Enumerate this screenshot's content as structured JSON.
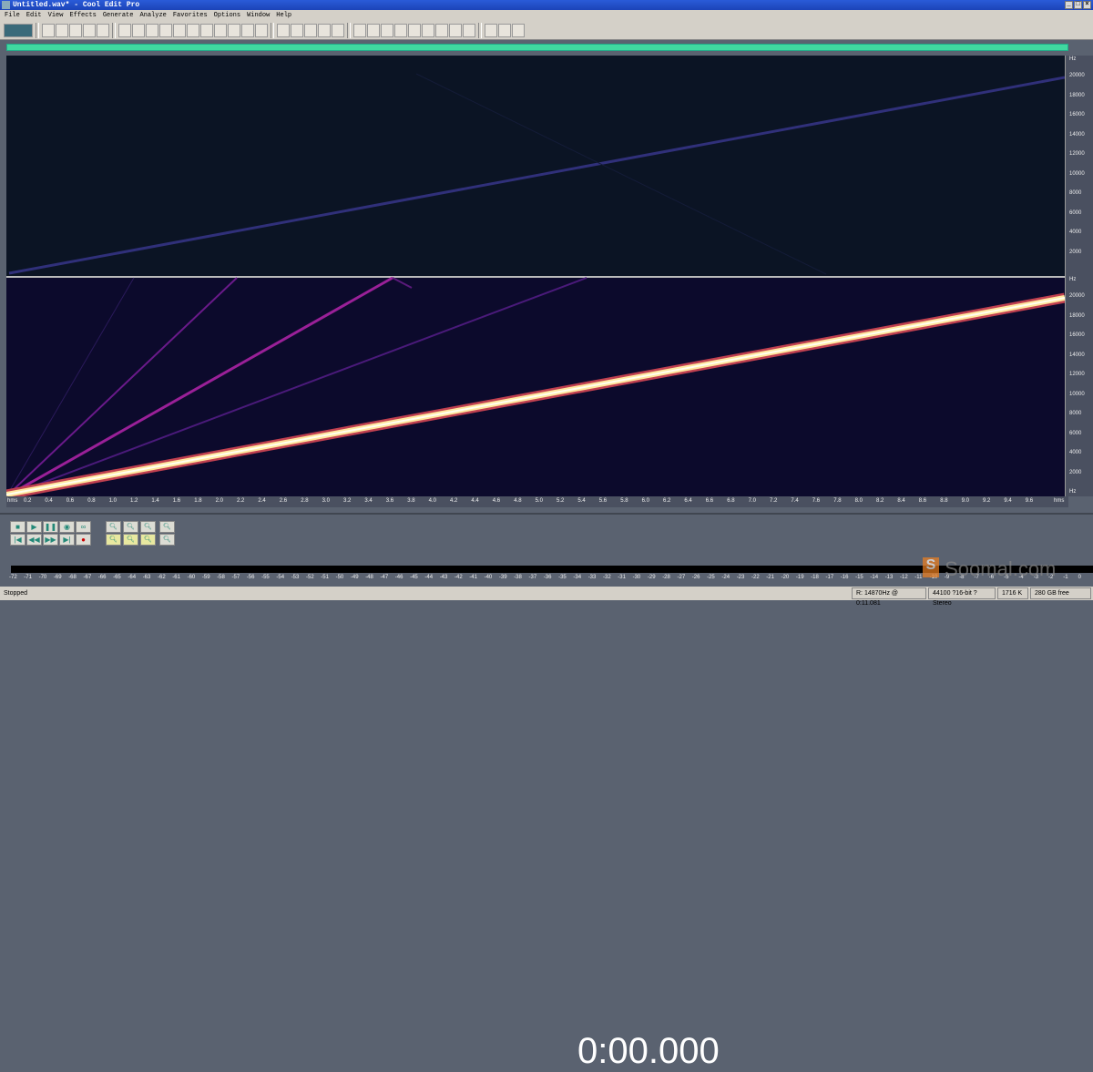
{
  "title": "Untitled.wav* - Cool Edit Pro",
  "menu": [
    "File",
    "Edit",
    "View",
    "Effects",
    "Generate",
    "Analyze",
    "Favorites",
    "Options",
    "Window",
    "Help"
  ],
  "toolbar_groups": [
    [
      "waveform-spectral-toggle"
    ],
    [
      "new",
      "open",
      "save",
      "save-as",
      "close"
    ],
    [
      "undo",
      "redo",
      "repeat",
      "copy",
      "copy-new",
      "cut",
      "paste",
      "paste-new",
      "mix-paste",
      "trim",
      "snap"
    ],
    [
      "spectral-view",
      "marker",
      "cue",
      "time-window",
      "play-list"
    ],
    [
      "info",
      "frequency-analysis",
      "phase",
      "play-cursor",
      "zoom",
      "level-bar",
      "time-display",
      "transport",
      "status"
    ],
    [
      "settings",
      "effect",
      "help"
    ]
  ],
  "freq_labels": [
    "20000",
    "18000",
    "16000",
    "14000",
    "12000",
    "10000",
    "8000",
    "6000",
    "4000",
    "2000"
  ],
  "freq_unit": "Hz",
  "time_unit": "hms",
  "time_labels": [
    "0.2",
    "0.4",
    "0.6",
    "0.8",
    "1.0",
    "1.2",
    "1.4",
    "1.6",
    "1.8",
    "2.0",
    "2.2",
    "2.4",
    "2.6",
    "2.8",
    "3.0",
    "3.2",
    "3.4",
    "3.6",
    "3.8",
    "4.0",
    "4.2",
    "4.4",
    "4.6",
    "4.8",
    "5.0",
    "5.2",
    "5.4",
    "5.6",
    "5.8",
    "6.0",
    "6.2",
    "6.4",
    "6.6",
    "6.8",
    "7.0",
    "7.2",
    "7.4",
    "7.6",
    "7.8",
    "8.0",
    "8.2",
    "8.4",
    "8.6",
    "8.8",
    "9.0",
    "9.2",
    "9.4",
    "9.6"
  ],
  "transport": [
    "stop",
    "play",
    "pause",
    "play-from-cursor",
    "loop",
    "go-start",
    "rewind",
    "fast-forward",
    "go-end",
    "record"
  ],
  "zoom_buttons": [
    "zoom-in",
    "zoom-out",
    "zoom-full",
    "zoom-in-left",
    "zoom-in-right",
    "zoom-selection",
    "zoom-vertical-in",
    "zoom-vertical-out"
  ],
  "time_display": "0:00.000",
  "meter_labels": [
    "-72",
    "-71",
    "-70",
    "-69",
    "-68",
    "-67",
    "-66",
    "-65",
    "-64",
    "-63",
    "-62",
    "-61",
    "-60",
    "-59",
    "-58",
    "-57",
    "-56",
    "-55",
    "-54",
    "-53",
    "-52",
    "-51",
    "-50",
    "-49",
    "-48",
    "-47",
    "-46",
    "-45",
    "-44",
    "-43",
    "-42",
    "-41",
    "-40",
    "-39",
    "-38",
    "-37",
    "-36",
    "-35",
    "-34",
    "-33",
    "-32",
    "-31",
    "-30",
    "-29",
    "-28",
    "-27",
    "-26",
    "-25",
    "-24",
    "-23",
    "-22",
    "-21",
    "-20",
    "-19",
    "-18",
    "-17",
    "-16",
    "-15",
    "-14",
    "-13",
    "-12",
    "-11",
    "-10",
    "-9",
    "-8",
    "-7",
    "-6",
    "-5",
    "-4",
    "-3",
    "-2",
    "-1",
    "0"
  ],
  "status": {
    "state": "Stopped",
    "cursor": "R: 14870Hz @ 0:11.081",
    "format": "44100 ?16-bit ?Stereo",
    "size": "1716 K",
    "free": "280 GB free"
  },
  "watermark": "Soomal.com"
}
